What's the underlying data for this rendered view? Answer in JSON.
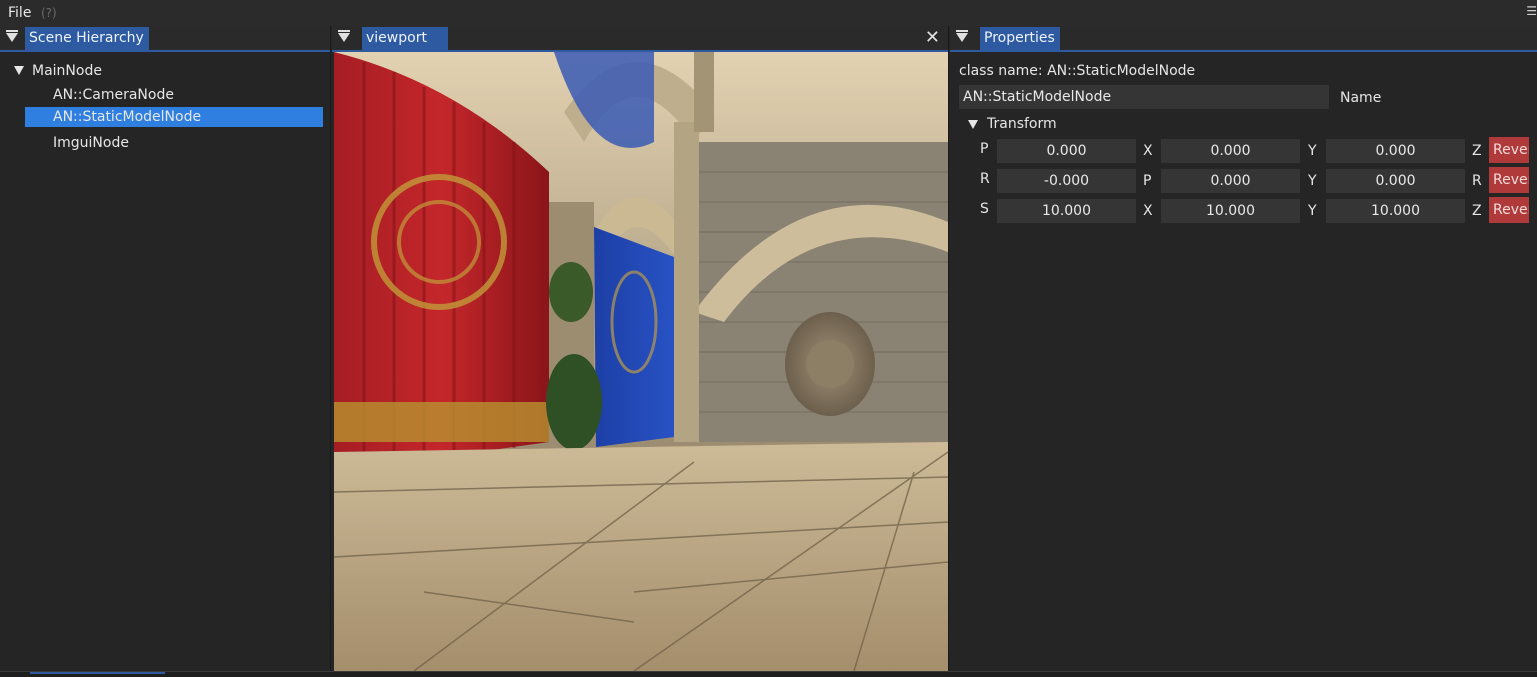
{
  "menu": {
    "file_label": "File",
    "help_label": "(?)"
  },
  "hierarchy": {
    "tab_label": "Scene Hierarchy",
    "root_label": "MainNode",
    "children": [
      "AN::CameraNode",
      "AN::StaticModelNode",
      "ImguiNode"
    ],
    "selected_index": 1
  },
  "viewport": {
    "tab_label": "viewport",
    "close_glyph": "✕"
  },
  "properties": {
    "tab_label": "Properties",
    "class_name_line": "class name: AN::StaticModelNode",
    "name_value": "AN::StaticModelNode",
    "name_label": "Name",
    "transform_label": "Transform",
    "rows": [
      {
        "label": "P",
        "values": [
          "0.000",
          "0.000",
          "0.000"
        ],
        "axes": [
          "X",
          "Y",
          "Z"
        ],
        "revert_label": "Revert"
      },
      {
        "label": "R",
        "values": [
          "-0.000",
          "0.000",
          "0.000"
        ],
        "axes": [
          "P",
          "Y",
          "R"
        ],
        "revert_label": "Revert"
      },
      {
        "label": "S",
        "values": [
          "10.000",
          "10.000",
          "10.000"
        ],
        "axes": [
          "X",
          "Y",
          "Z"
        ],
        "revert_label": "Revert"
      }
    ]
  },
  "colors": {
    "accent": "#2d5aa0",
    "selection": "#2f7fe0",
    "revert": "#b03a3a"
  }
}
